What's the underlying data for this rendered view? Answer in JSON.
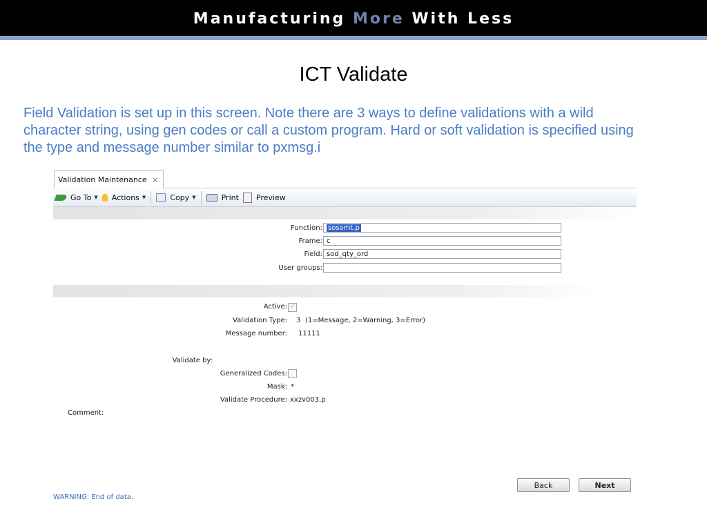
{
  "banner": {
    "title_part1": "Manufacturing ",
    "title_accent": "More",
    "title_part2": " With Less"
  },
  "slide": {
    "title": "ICT Validate",
    "description": "Field Validation is set up in this screen. Note there are 3 ways to define validations with a wild character string, using gen codes or call a custom program. Hard or soft validation is specified using the type and message number similar to pxmsg.i"
  },
  "app": {
    "tab": {
      "label": "Validation Maintenance",
      "close": "✕"
    },
    "toolbar": {
      "goto": "Go To",
      "actions": "Actions",
      "copy": "Copy",
      "print": "Print",
      "preview": "Preview"
    },
    "form": {
      "function_label": "Function:",
      "function_value": "sosomt.p",
      "frame_label": "Frame:",
      "frame_value": "c",
      "field_label": "Field:",
      "field_value": "sod_qty_ord",
      "usergroups_label": "User groups:",
      "usergroups_value": "",
      "active_label": "Active:",
      "active_checked": true,
      "validation_type_label": "Validation Type:",
      "validation_type_value": "3",
      "validation_type_hint": "(1=Message, 2=Warning, 3=Error)",
      "message_number_label": "Message number:",
      "message_number_value": "11111",
      "validate_by_label": "Validate by:",
      "gencodes_label": "Generalized Codes:",
      "gencodes_checked": false,
      "mask_label": "Mask:",
      "mask_value": "*",
      "procedure_label": "Validate Procedure:",
      "procedure_value": "xxzv003.p",
      "comment_label": "Comment:"
    },
    "buttons": {
      "back": "Back",
      "next": "Next"
    },
    "status": "WARNING: End of data."
  }
}
